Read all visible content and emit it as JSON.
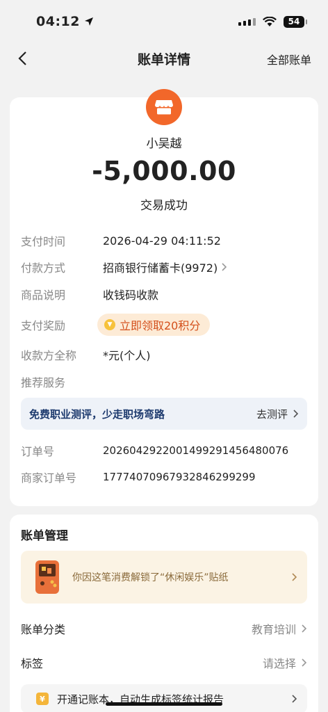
{
  "status_bar": {
    "time": "04:12",
    "battery": "54"
  },
  "nav": {
    "title": "账单详情",
    "right_link": "全部账单"
  },
  "transaction": {
    "merchant": "小吴越",
    "amount": "-5,000.00",
    "status": "交易成功"
  },
  "details": {
    "pay_time_label": "支付时间",
    "pay_time_value": "2026-04-29 04:11:52",
    "pay_method_label": "付款方式",
    "pay_method_value": "招商银行储蓄卡(9972)",
    "goods_label": "商品说明",
    "goods_value": "收钱码收款",
    "reward_label": "支付奖励",
    "reward_value": "立即领取20积分",
    "payee_label": "收款方全称",
    "payee_value": "*元(个人)",
    "recommend_label": "推荐服务",
    "order_label": "订单号",
    "order_value": "20260429220014992914564800​76",
    "merchant_order_label": "商家订单号",
    "merchant_order_value": "17774070967932846299299"
  },
  "promo": {
    "text": "免费职业测评，少走职场弯路",
    "action": "去测评"
  },
  "manage": {
    "title": "账单管理",
    "sticker_text": "你因这笔消费解锁了“休闲娱乐”贴纸",
    "category_label": "账单分类",
    "category_value": "教育培训",
    "tag_label": "标签",
    "tag_value": "请选择",
    "ledger_text": "开通记账本，自动生成标签统计报告"
  },
  "colors": {
    "accent": "#f2672a",
    "reward": "#d4501c",
    "promo_text": "#1d3a6e"
  }
}
